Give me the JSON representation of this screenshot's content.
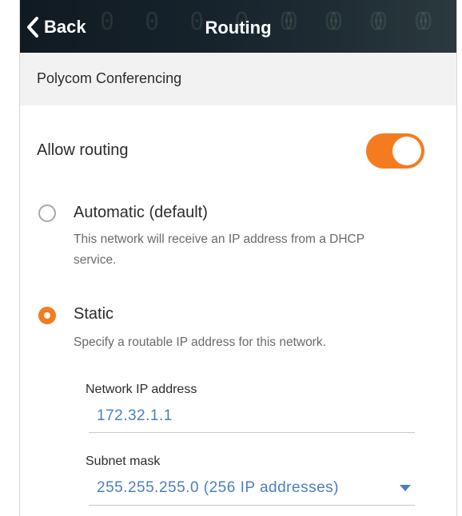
{
  "nav": {
    "back_label": "Back",
    "title": "Routing",
    "background_digits": "0 0   0 0 0   0 0 0"
  },
  "section": {
    "header": "Polycom Conferencing"
  },
  "allow_routing": {
    "label": "Allow routing",
    "enabled": true
  },
  "options": [
    {
      "title": "Automatic (default)",
      "description_line1": "This network will receive an IP address from a DHCP",
      "description_line2": "service.",
      "selected": false
    },
    {
      "title": "Static",
      "description_line1": "Specify a routable IP address for this network.",
      "selected": true
    }
  ],
  "fields": {
    "network_ip": {
      "label": "Network IP address",
      "value": "172.32.1.1"
    },
    "subnet_mask": {
      "label": "Subnet mask",
      "value": "255.255.255.0 (256 IP addresses)"
    }
  },
  "colors": {
    "accent": "#f47b1f",
    "link_blue": "#4a7fc1",
    "nav_bg": "#16222b",
    "section_bg": "#f2f2f2"
  }
}
